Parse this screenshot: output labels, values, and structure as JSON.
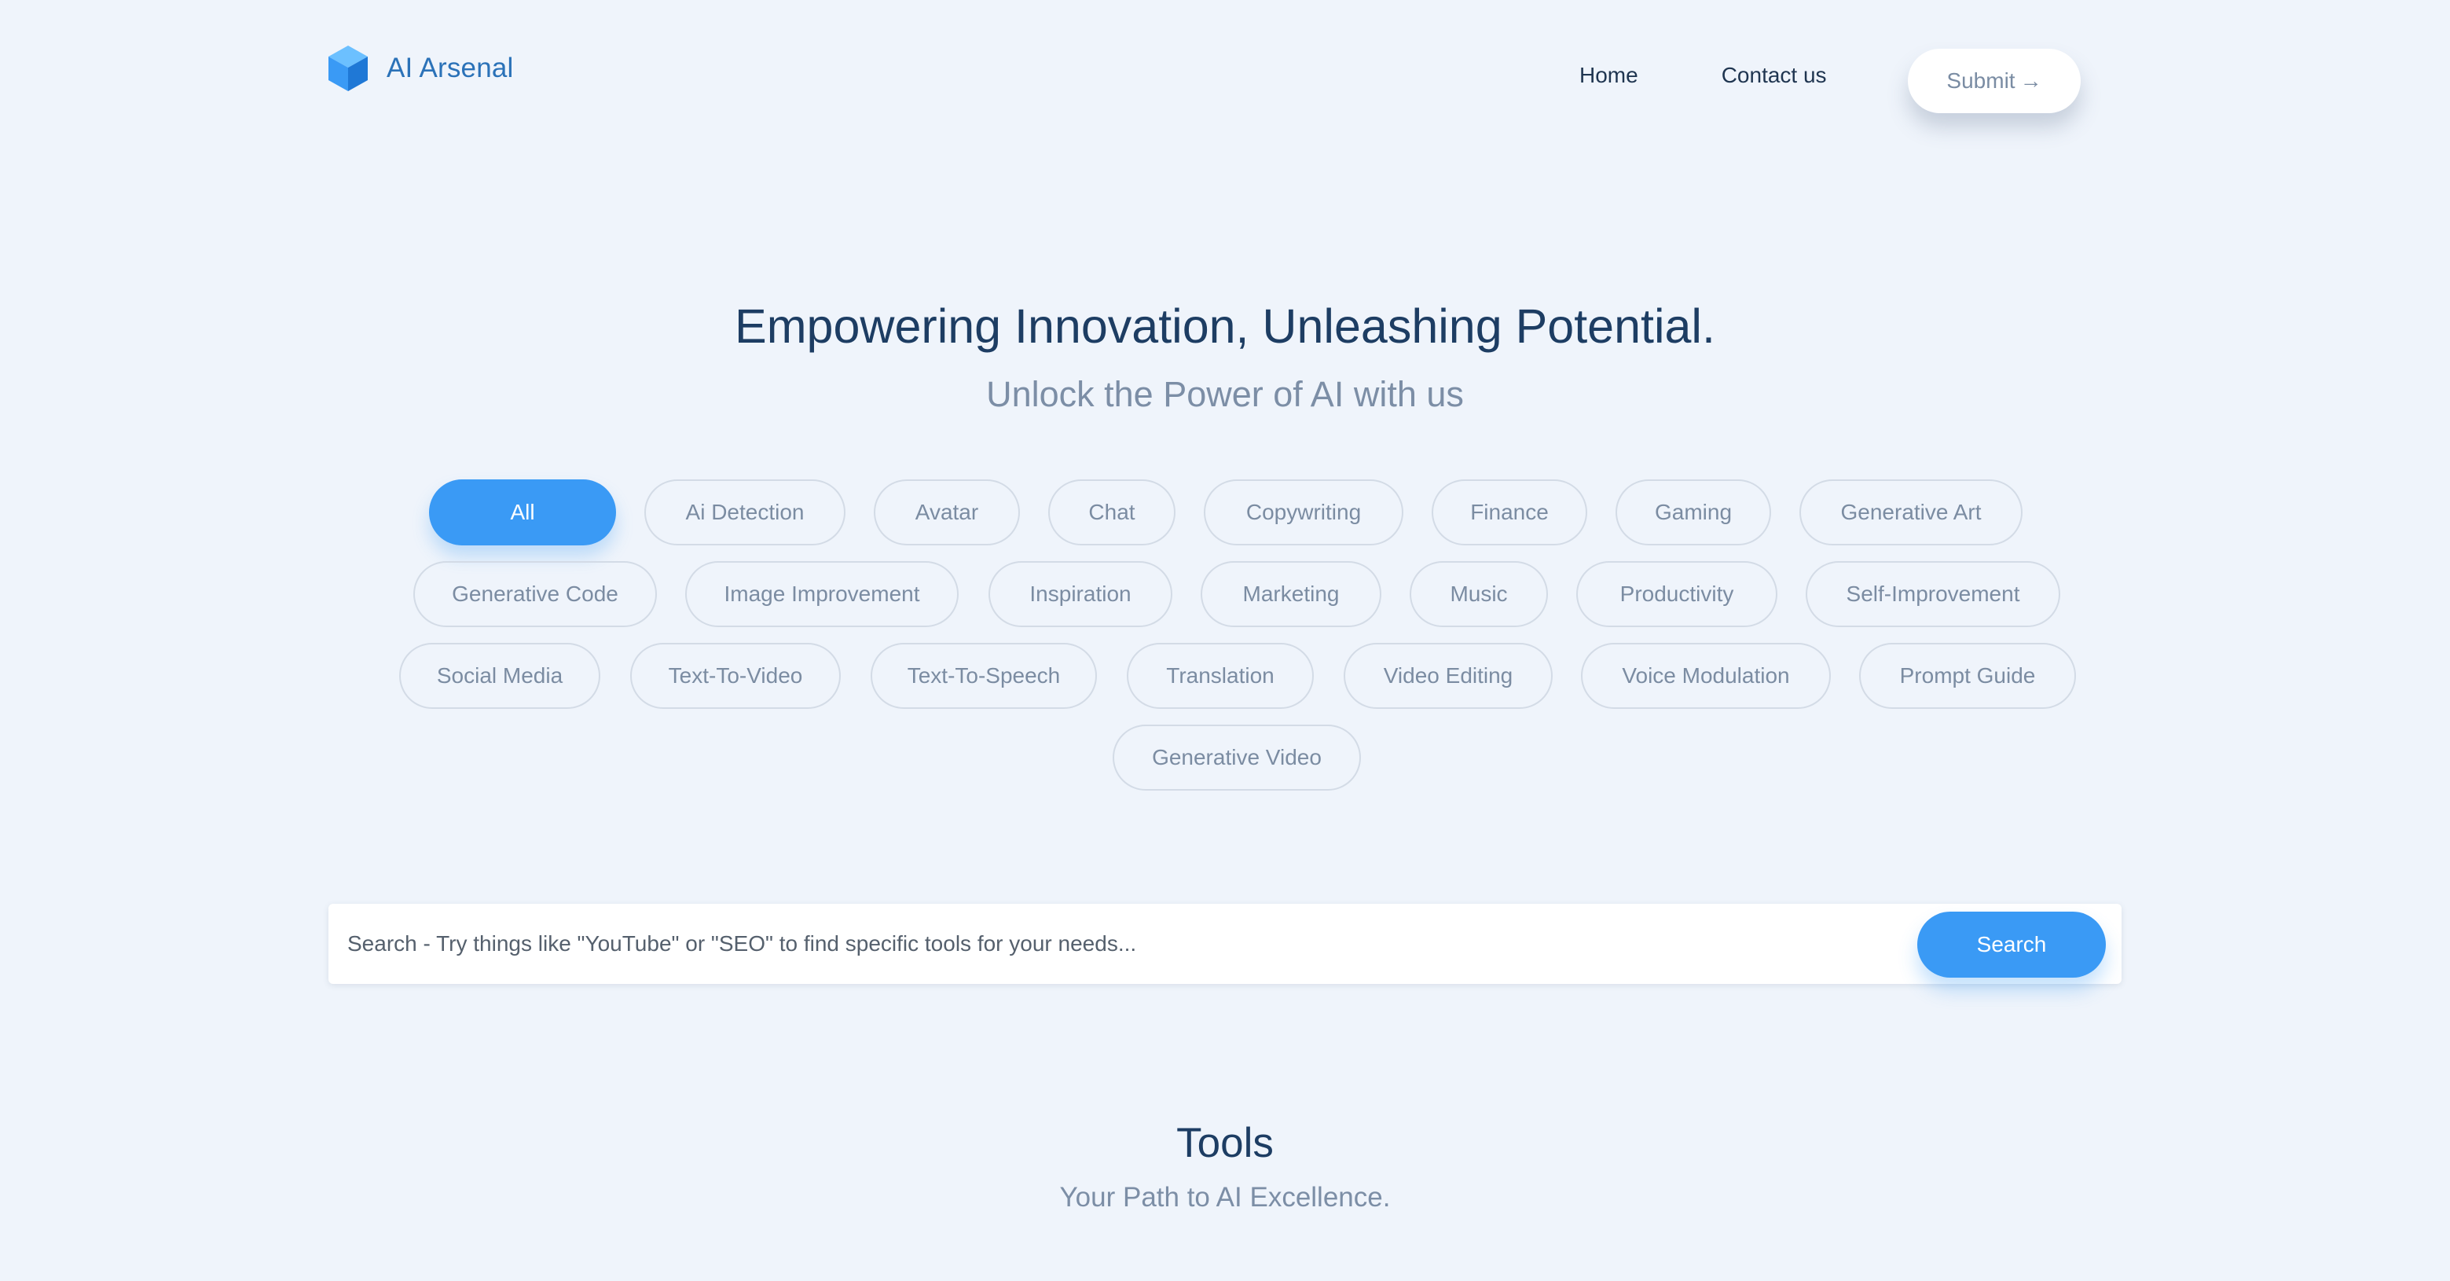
{
  "brand": {
    "name": "AI Arsenal",
    "logo_icon": "cube-icon",
    "logo_color": "#3a9af5"
  },
  "nav": {
    "links": [
      "Home",
      "Contact us"
    ],
    "submit_label": "Submit",
    "submit_arrow": "→"
  },
  "hero": {
    "title": "Empowering Innovation, Unleashing Potential.",
    "subtitle": "Unlock the Power of AI with us"
  },
  "categories": {
    "selected": "All",
    "items": [
      "All",
      "Ai Detection",
      "Avatar",
      "Chat",
      "Copywriting",
      "Finance",
      "Gaming",
      "Generative Art",
      "Generative Code",
      "Image Improvement",
      "Inspiration",
      "Marketing",
      "Music",
      "Productivity",
      "Self-Improvement",
      "Social Media",
      "Text-To-Video",
      "Text-To-Speech",
      "Translation",
      "Video Editing",
      "Voice Modulation",
      "Prompt Guide",
      "Generative Video"
    ]
  },
  "search": {
    "placeholder": "Search - Try things like \"YouTube\" or \"SEO\" to find specific tools for your needs...",
    "value": "",
    "button_label": "Search"
  },
  "tools": {
    "title": "Tools",
    "subtitle": "Your Path to AI Excellence."
  },
  "colors": {
    "accent": "#3a9af5",
    "background": "#eff4fb",
    "heading": "#1d3d63",
    "muted": "#7c8ea6"
  }
}
